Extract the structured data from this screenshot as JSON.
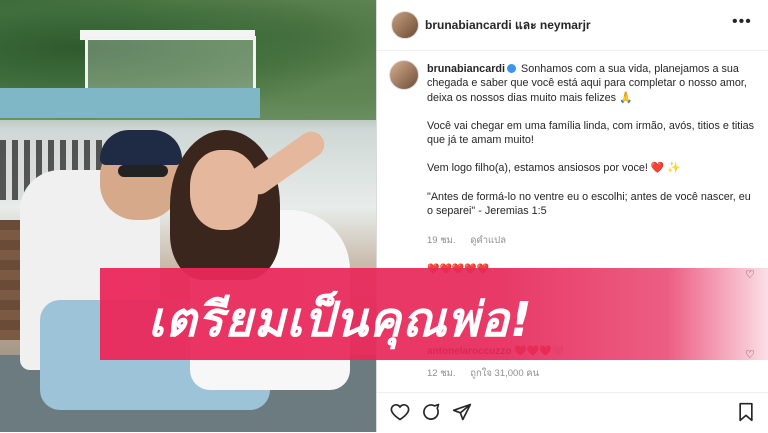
{
  "post": {
    "header": {
      "title": "brunabiancardi และ neymarjr",
      "more_icon": "more-horizontal-icon"
    },
    "caption": {
      "username": "brunabiancardi",
      "paragraphs": [
        "Sonhamos com a sua vida, planejamos a sua chegada e saber que você está aqui para completar o nosso amor, deixa os nossos dias muito mais felizes 🙏",
        "Você vai chegar em uma família linda, com irmão, avós, titios e titias que já te amam muito!",
        "Vem logo filho(a), estamos ansiosos por voce! ❤️ ✨",
        "\"Antes de formá-lo no ventre eu o escolhi; antes de você nascer, eu o separei\" - Jeremias 1:5"
      ],
      "time": "19 ชม.",
      "see_translation": "ดูคำแปล"
    },
    "reply1": {
      "text": "❤️❤️❤️❤️❤️"
    },
    "reply2": {
      "username": "antonelaroccuzzo",
      "text": "❤️❤️❤️🤍",
      "time": "12 ชม.",
      "likes": "ถูกใจ 31,000 คน"
    },
    "actions": [
      "heart-icon",
      "comment-icon",
      "share-icon",
      "save-icon"
    ]
  },
  "banner": {
    "text": "เตรียมเป็นคุณพ่อ!",
    "color": "#EB285A"
  }
}
